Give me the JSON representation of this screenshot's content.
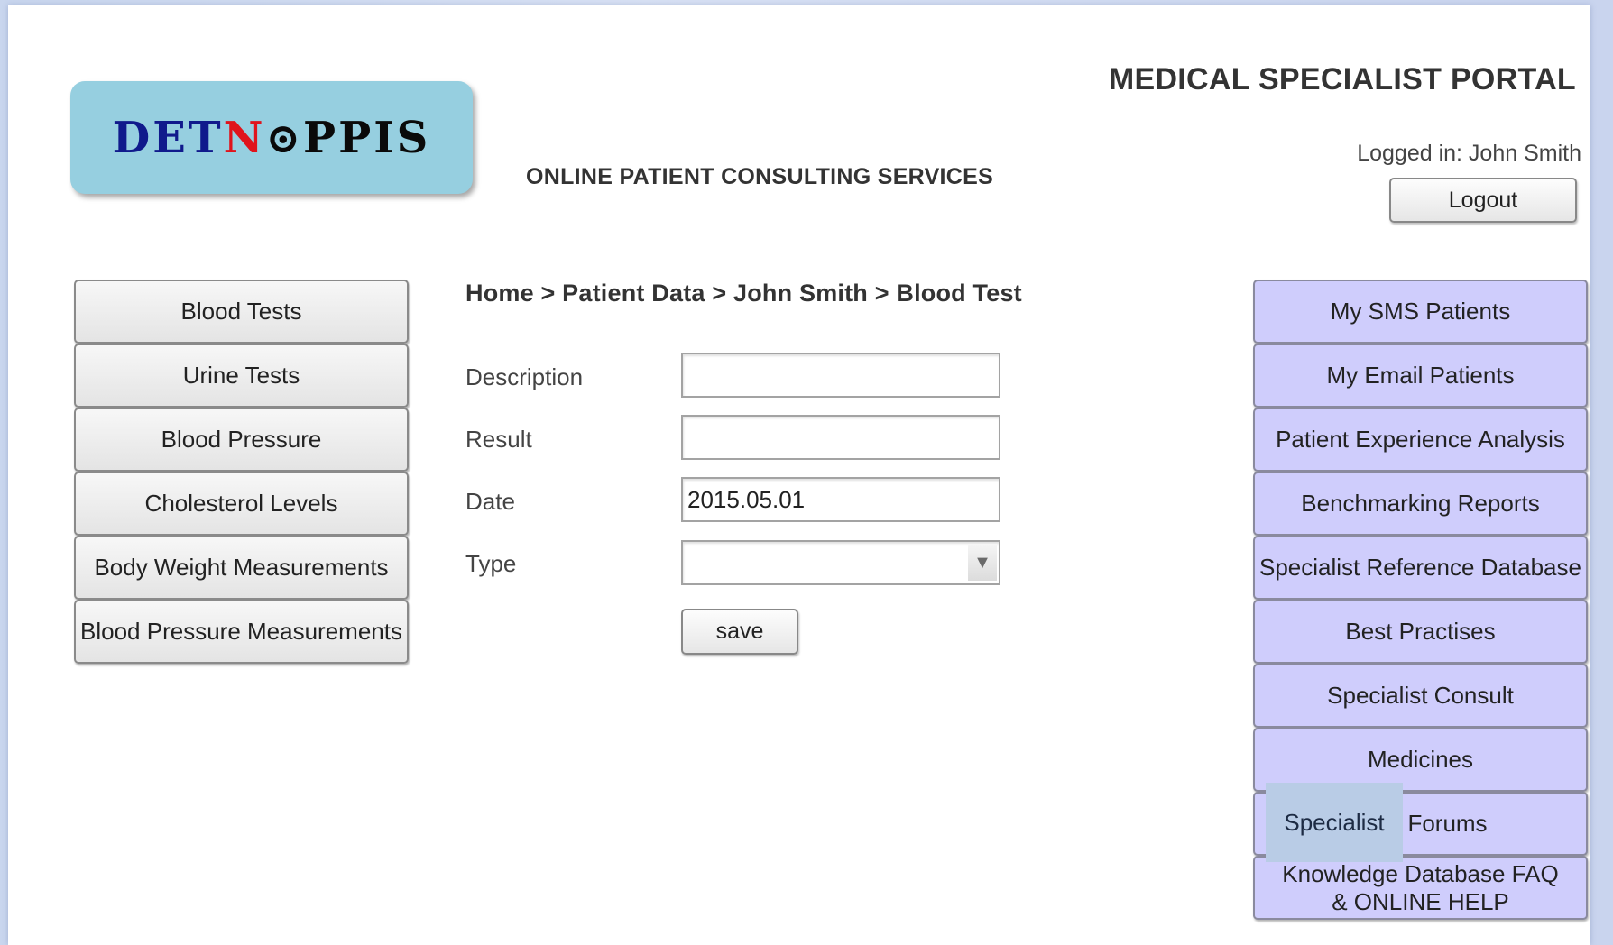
{
  "header": {
    "logo": {
      "part1": "DET",
      "part2": "N",
      "ring": "⊙",
      "part3": "PPIS"
    },
    "subtitle": "ONLINE PATIENT CONSULTING SERVICES",
    "portal_title": "MEDICAL SPECIALIST PORTAL",
    "logged_in": "Logged in: John Smith",
    "logout_label": "Logout"
  },
  "left_nav": {
    "items": [
      {
        "label": "Blood Tests"
      },
      {
        "label": "Urine Tests"
      },
      {
        "label": "Blood Pressure"
      },
      {
        "label": "Cholesterol Levels"
      },
      {
        "label": "Body Weight Measurements"
      },
      {
        "label": "Blood Pressure Measurements"
      }
    ]
  },
  "breadcrumb": "Home > Patient Data > John Smith > Blood Test",
  "form": {
    "description": {
      "label": "Description",
      "value": ""
    },
    "result": {
      "label": "Result",
      "value": ""
    },
    "date": {
      "label": "Date",
      "value": "2015.05.01"
    },
    "type": {
      "label": "Type",
      "value": ""
    },
    "save_label": "save"
  },
  "right_nav": {
    "items": [
      {
        "label": "My SMS Patients"
      },
      {
        "label": "My Email Patients"
      },
      {
        "label": "Patient Experience Analysis"
      },
      {
        "label": "Benchmarking Reports"
      },
      {
        "label": "Specialist Reference Database"
      },
      {
        "label": "Best Practises"
      },
      {
        "label": "Specialist Consult"
      },
      {
        "label": "Medicines"
      },
      {
        "label": "Forums"
      },
      {
        "label": "Knowledge Database FAQ & ONLINE HELP"
      }
    ]
  },
  "tooltip": "Specialist"
}
